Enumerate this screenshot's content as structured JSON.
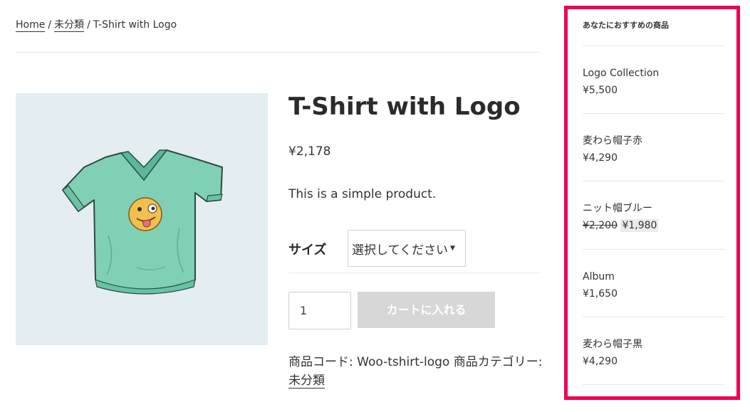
{
  "breadcrumb": {
    "home": "Home",
    "sep1": "/",
    "category": "未分類",
    "sep2": "/",
    "current": "T-Shirt with Logo"
  },
  "product": {
    "title": "T-Shirt with Logo",
    "price": "¥2,178",
    "short_description": "This is a simple product.",
    "variation_label": "サイズ",
    "variation_select_value": "選択してください",
    "quantity": "1",
    "add_to_cart_label": "カートに入れる",
    "meta_sku_label": "商品コード:",
    "meta_sku": "Woo-tshirt-logo",
    "meta_category_label": "商品カテゴリー:",
    "meta_category": "未分類"
  },
  "sidebar": {
    "title": "あなたにおすすめの商品",
    "items": [
      {
        "name": "Logo Collection",
        "price": "¥5,500"
      },
      {
        "name": "麦わら帽子赤",
        "price": "¥4,290"
      },
      {
        "name": "ニット帽ブルー",
        "old_price": "¥2,200",
        "sale_price": "¥1,980"
      },
      {
        "name": "Album",
        "price": "¥1,650"
      },
      {
        "name": "麦わら帽子黒",
        "price": "¥4,290"
      }
    ]
  },
  "colors": {
    "sidebar_highlight": "#ee0050",
    "image_background": "#e4edf1",
    "shirt": "#7fd0b4",
    "disabled_button": "#d7d7d7"
  },
  "icons": {
    "product_image": "tshirt-with-emoji-logo",
    "select_caret": "caret-down-icon"
  }
}
